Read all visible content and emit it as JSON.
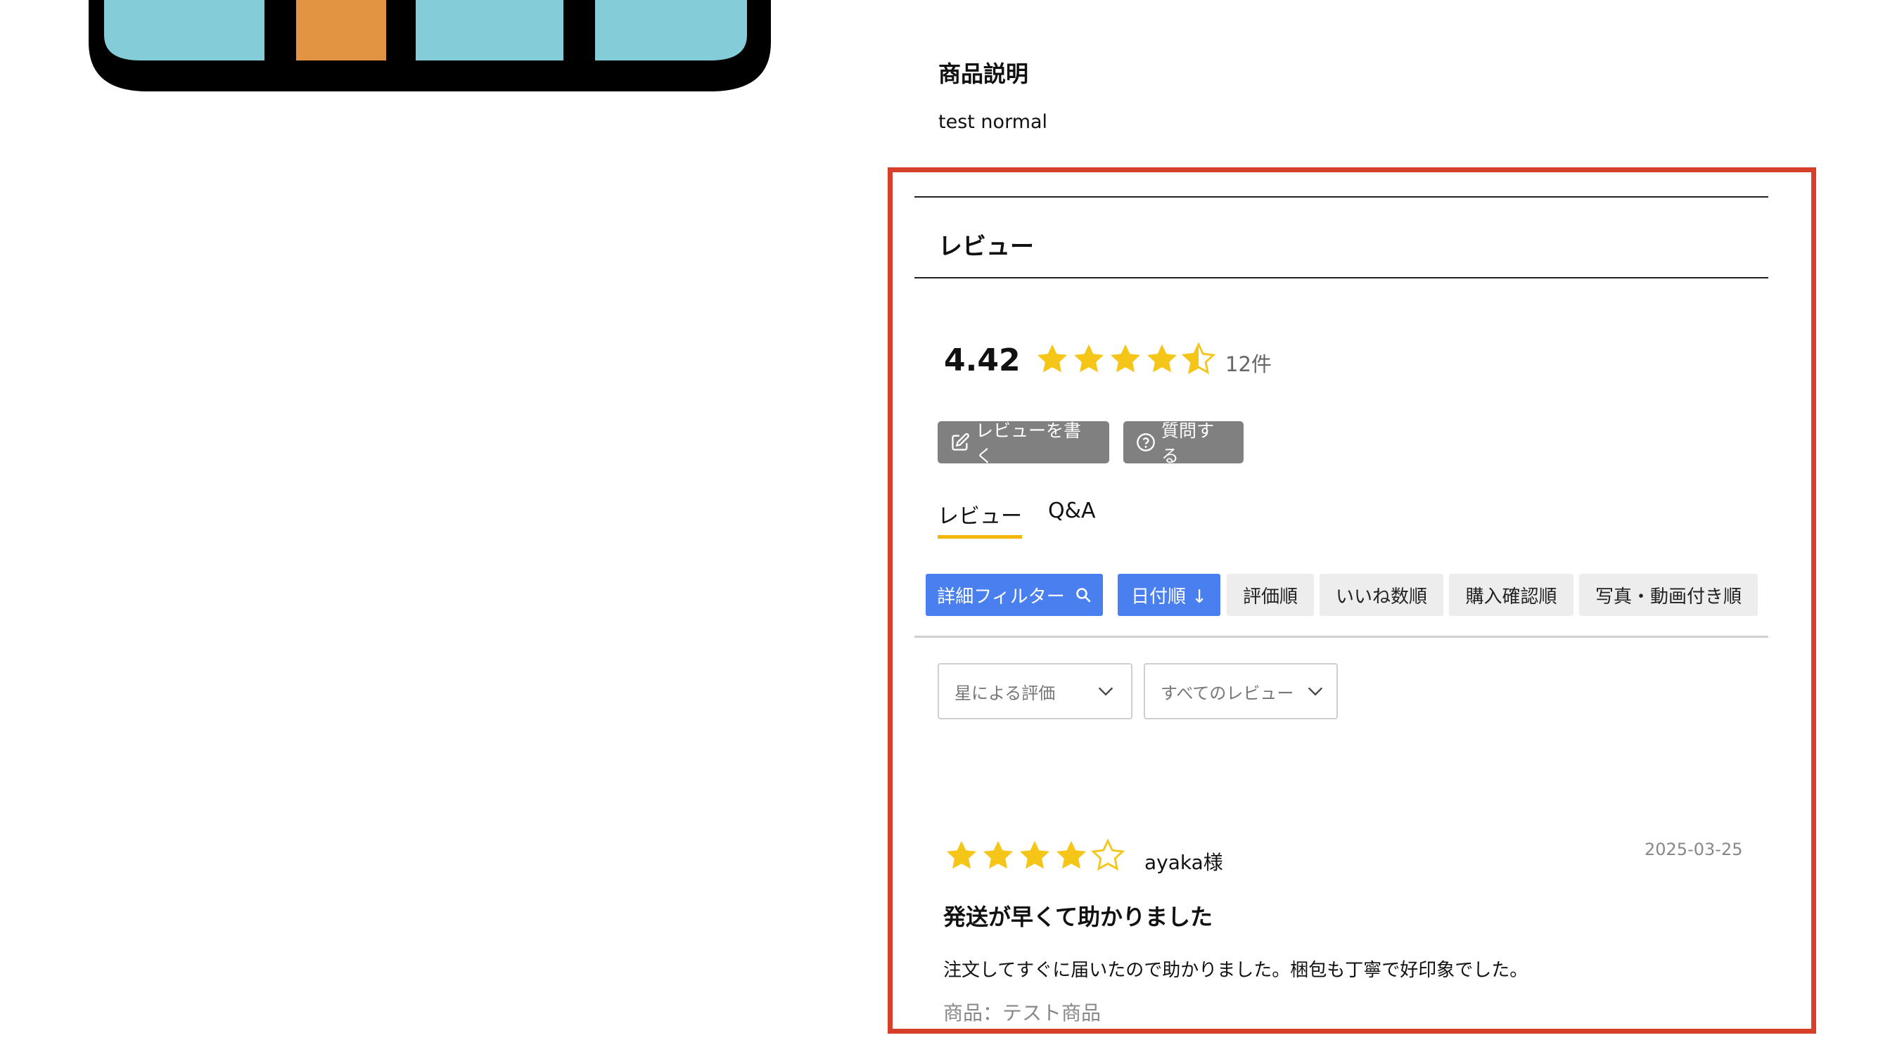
{
  "colors": {
    "accent_blue": "#4a7fef",
    "star_yellow": "#f5c518",
    "tab_underline": "#f2b600",
    "highlight_red": "#d6402b",
    "button_grey": "#808080"
  },
  "description": {
    "heading": "商品説明",
    "text": "test normal"
  },
  "reviews": {
    "heading": "レビュー",
    "summary": {
      "average": "4.42",
      "rating_value": 4.42,
      "star_icons": [
        "star-full-icon",
        "star-full-icon",
        "star-full-icon",
        "star-full-icon",
        "star-half-icon"
      ],
      "count": "12件"
    },
    "actions": {
      "write_label": "レビューを書く",
      "ask_label": "質問する"
    },
    "tabs": {
      "reviews_label": "レビュー",
      "qa_label": "Q&A",
      "active": "reviews"
    },
    "sort_chips": {
      "filter_label": "詳細フィルター",
      "date_label": "日付順 ↓",
      "rating_label": "評価順",
      "likes_label": "いいね数順",
      "verified_label": "購入確認順",
      "photo_label": "写真・動画付き順"
    },
    "selects": {
      "stars_value": "星による評価",
      "type_value": "すべてのレビュー"
    },
    "items": [
      {
        "rating": 4,
        "reviewer": "ayaka様",
        "date": "2025-03-25",
        "title": "発送が早くて助かりました",
        "body": "注文してすぐに届いたので助かりました。梱包も丁寧で好印象でした。",
        "product": "商品：テスト商品"
      }
    ]
  }
}
